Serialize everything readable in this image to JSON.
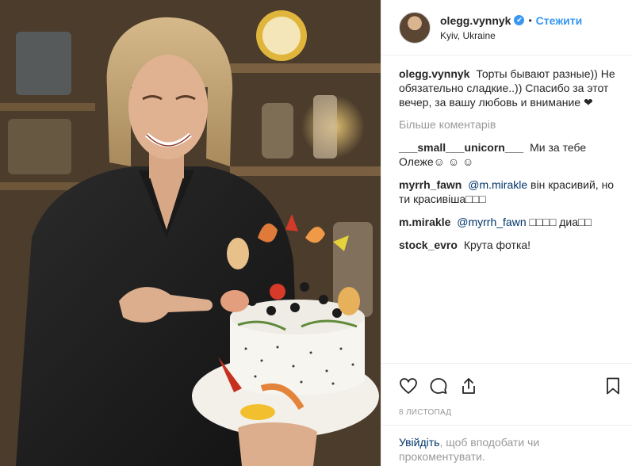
{
  "post": {
    "username": "olegg.vynnyk",
    "verified_badge": "✔",
    "separator": "•",
    "follow_label": "Стежити",
    "location": "Kyiv, Ukraine"
  },
  "caption": {
    "user": "olegg.vynnyk",
    "text": "Торты бывают разные)) Не обязательно сладкие..)) Спасибо за этот вечер, за вашу любовь и внимание ❤"
  },
  "more_comments_label": "Більше коментарів",
  "comments": [
    {
      "user": "___small___unicorn___",
      "text": "Ми за тебе Олеже☺ ☺ ☺",
      "mention": ""
    },
    {
      "user": "myrrh_fawn",
      "mention": "@m.mirakle",
      "text": "він красивий, но ти красивіша□□□"
    },
    {
      "user": "m.mirakle",
      "mention": "@myrrh_fawn",
      "text": "□□□□ диа□□"
    },
    {
      "user": "stock_evro",
      "text": "Крута фотка!",
      "mention": ""
    }
  ],
  "icons": {
    "like": "heart-icon",
    "comment": "comment-bubble-icon",
    "share": "share-icon",
    "save": "bookmark-icon"
  },
  "date": "8 листопад",
  "login_prompt": {
    "link": "Увійдіть",
    "text": ", щоб вподобати чи прокоментувати."
  },
  "colors": {
    "link_blue": "#3897f0",
    "mention_blue": "#003569",
    "muted": "#999999",
    "border": "#efefef"
  }
}
